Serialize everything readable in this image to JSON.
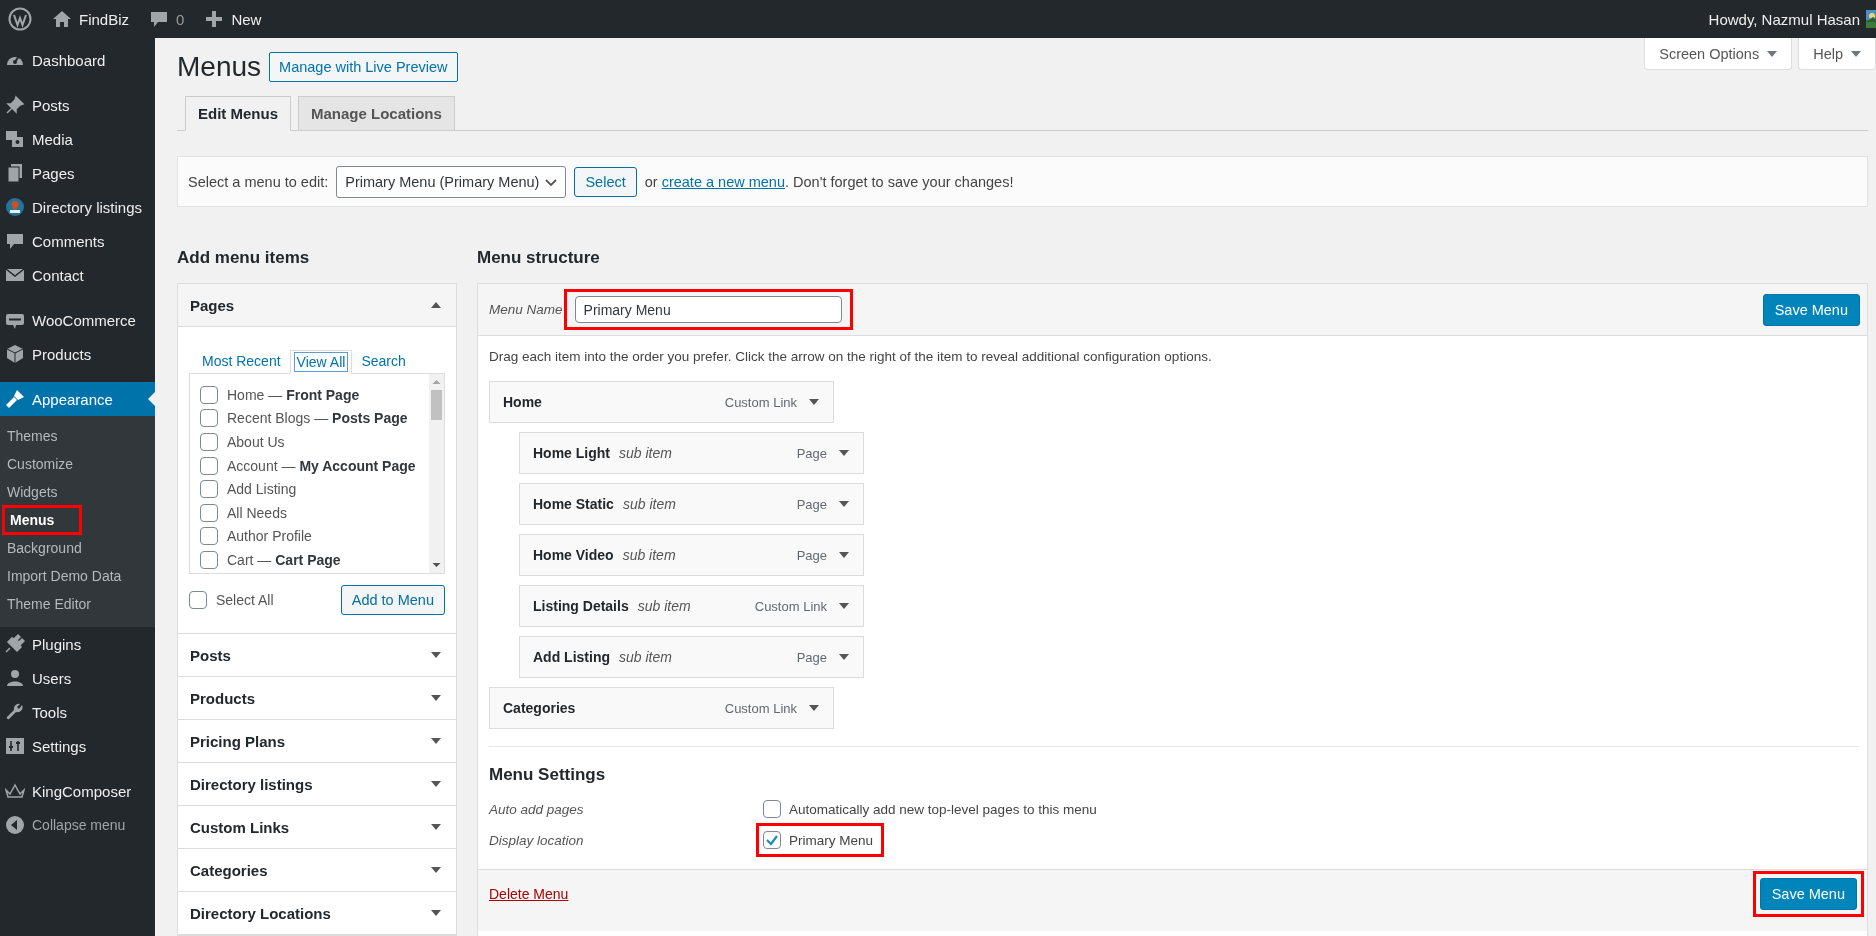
{
  "admin_bar": {
    "site_name": "FindBiz",
    "comment_count": "0",
    "new_label": "New",
    "greeting": "Howdy, Nazmul Hasan"
  },
  "sidebar": {
    "groups": [
      [
        {
          "label": "Dashboard",
          "kind": "menu",
          "selected": false
        }
      ],
      [
        {
          "label": "Posts",
          "kind": "menu",
          "selected": false
        },
        {
          "label": "Media",
          "kind": "menu",
          "selected": false
        },
        {
          "label": "Pages",
          "kind": "menu",
          "selected": false
        },
        {
          "label": "Directory listings",
          "kind": "menu",
          "selected": false
        },
        {
          "label": "Comments",
          "kind": "menu",
          "selected": false
        },
        {
          "label": "Contact",
          "kind": "menu",
          "selected": false
        }
      ],
      [
        {
          "label": "WooCommerce",
          "kind": "menu",
          "selected": false
        },
        {
          "label": "Products",
          "kind": "menu",
          "selected": false
        }
      ],
      [
        {
          "label": "Appearance",
          "kind": "menu",
          "selected": true,
          "children": [
            {
              "label": "Themes",
              "selected": false,
              "highlighted": false
            },
            {
              "label": "Customize",
              "selected": false,
              "highlighted": false
            },
            {
              "label": "Widgets",
              "selected": false,
              "highlighted": false
            },
            {
              "label": "Menus",
              "selected": true,
              "highlighted": true
            },
            {
              "label": "Background",
              "selected": false,
              "highlighted": false
            },
            {
              "label": "Import Demo Data",
              "selected": false,
              "highlighted": false
            },
            {
              "label": "Theme Editor",
              "selected": false,
              "highlighted": false
            }
          ]
        },
        {
          "label": "Plugins",
          "kind": "menu",
          "selected": false
        },
        {
          "label": "Users",
          "kind": "menu",
          "selected": false
        },
        {
          "label": "Tools",
          "kind": "menu",
          "selected": false
        },
        {
          "label": "Settings",
          "kind": "menu",
          "selected": false
        }
      ],
      [
        {
          "label": "KingComposer",
          "kind": "menu",
          "selected": false
        },
        {
          "label": "Collapse menu",
          "kind": "collapse",
          "selected": false
        }
      ]
    ]
  },
  "page": {
    "title": "Menus",
    "live_preview_button": "Manage with Live Preview",
    "screen_options": "Screen Options",
    "help": "Help",
    "tabs": [
      {
        "label": "Edit Menus",
        "selected": true
      },
      {
        "label": "Manage Locations",
        "selected": false
      }
    ]
  },
  "select_bar": {
    "label": "Select a menu to edit:",
    "menu_select": "Primary Menu (Primary Menu)",
    "select_button": "Select",
    "hint_before": "or ",
    "hint_link": "create a new menu",
    "hint_after": ". Don't forget to save your changes!"
  },
  "add_items": {
    "heading": "Add menu items",
    "sections": [
      {
        "title": "Pages",
        "expanded": true,
        "tabs": [
          {
            "label": "Most Recent",
            "selected": false
          },
          {
            "label": "View All",
            "selected": true
          },
          {
            "label": "Search",
            "selected": false
          }
        ],
        "pages": [
          {
            "title": "Home — **Front Page**",
            "checked": false
          },
          {
            "title": "Recent Blogs — **Posts Page**",
            "checked": false
          },
          {
            "title": "About Us",
            "checked": false
          },
          {
            "title": "Account — **My Account Page**",
            "checked": false
          },
          {
            "title": "Add Listing",
            "checked": false
          },
          {
            "title": "All Needs",
            "checked": false
          },
          {
            "title": "Author Profile",
            "checked": false
          },
          {
            "title": "Cart — **Cart Page**",
            "checked": false
          }
        ],
        "select_all": {
          "label": "Select All",
          "checked": false
        },
        "add_button": "Add to Menu"
      },
      {
        "title": "Posts",
        "expanded": false
      },
      {
        "title": "Products",
        "expanded": false
      },
      {
        "title": "Pricing Plans",
        "expanded": false
      },
      {
        "title": "Directory listings",
        "expanded": false
      },
      {
        "title": "Custom Links",
        "expanded": false
      },
      {
        "title": "Categories",
        "expanded": false
      },
      {
        "title": "Directory Locations",
        "expanded": false
      }
    ]
  },
  "structure": {
    "heading": "Menu structure",
    "menu_name_label": "Menu Name",
    "menu_name": "Primary Menu",
    "menu_name_highlighted": true,
    "save_button": "Save Menu",
    "instructions": "Drag each item into the order you prefer. Click the arrow on the right of the item to reveal additional configuration options.",
    "items": [
      {
        "title": "Home",
        "type": "Custom Link",
        "children": [
          {
            "title": "Home Light",
            "note": "sub item",
            "type": "Page"
          },
          {
            "title": "Home Static",
            "note": "sub item",
            "type": "Page"
          },
          {
            "title": "Home Video",
            "note": "sub item",
            "type": "Page"
          },
          {
            "title": "Listing Details",
            "note": "sub item",
            "type": "Custom Link"
          },
          {
            "title": "Add Listing",
            "note": "sub item",
            "type": "Page"
          }
        ]
      },
      {
        "title": "Categories",
        "type": "Custom Link"
      }
    ],
    "settings": {
      "heading": "Menu Settings",
      "rows": [
        {
          "label": "Auto add pages",
          "option": "Automatically add new top-level pages to this menu",
          "checked": false,
          "highlighted": false
        },
        {
          "label": "Display location",
          "option": "Primary Menu",
          "checked": true,
          "highlighted": true
        }
      ]
    },
    "footer": {
      "delete_link": "Delete Menu",
      "save_button": "Save Menu",
      "save_highlighted": true
    }
  }
}
